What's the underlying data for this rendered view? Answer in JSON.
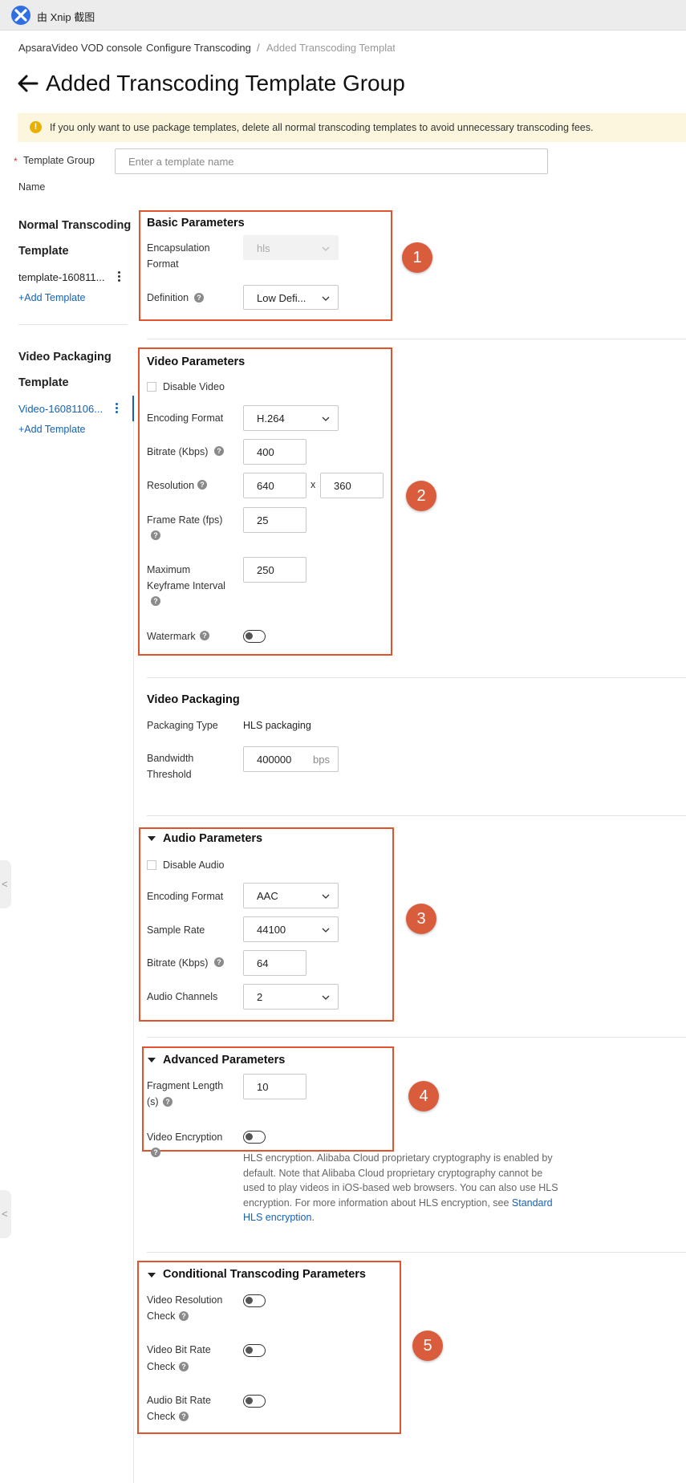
{
  "app": {
    "title": "由 Xnip 截图"
  },
  "breadcrumb": {
    "items": [
      "ApsaraVideo VOD console",
      "Configure Transcoding",
      "Added Transcoding Templat"
    ],
    "separator": "/"
  },
  "page": {
    "title": "Added Transcoding Template Group"
  },
  "notice": {
    "icon": "!",
    "text": "If you only want to use package templates, delete all normal transcoding templates to avoid unnecessary transcoding fees."
  },
  "template_group": {
    "required_mark": "*",
    "label_line1": "Template Group",
    "label_line2": "Name",
    "placeholder": "Enter a template name"
  },
  "sidebar": {
    "normal": {
      "heading_line1": "Normal Transcoding",
      "heading_line2": "Template",
      "item": "template-160811...",
      "add": "+Add Template"
    },
    "packaging": {
      "heading_line1": "Video Packaging",
      "heading_line2": "Template",
      "item": "Video-16081106...",
      "add": "+Add Template"
    }
  },
  "help_glyph": "?",
  "basic": {
    "title": "Basic Parameters",
    "encapsulation_label_1": "Encapsulation",
    "encapsulation_label_2": "Format",
    "encapsulation_value": "hls",
    "definition_label": "Definition",
    "definition_value": "Low Defi..."
  },
  "video": {
    "title": "Video Parameters",
    "disable_label": "Disable Video",
    "encoding_label": "Encoding Format",
    "encoding_value": "H.264",
    "bitrate_label": "Bitrate (Kbps)",
    "bitrate_value": "400",
    "resolution_label": "Resolution",
    "width": "640",
    "times": "x",
    "height": "360",
    "framerate_label": "Frame Rate (fps)",
    "framerate_value": "25",
    "keyframe_label_1": "Maximum",
    "keyframe_label_2": "Keyframe Interval",
    "keyframe_value": "250",
    "watermark_label": "Watermark"
  },
  "packaging": {
    "title": "Video Packaging",
    "type_label": "Packaging Type",
    "type_value": "HLS packaging",
    "bandwidth_label_1": "Bandwidth",
    "bandwidth_label_2": "Threshold",
    "bandwidth_value": "400000",
    "bandwidth_unit": "bps"
  },
  "audio": {
    "title": "Audio Parameters",
    "disable_label": "Disable Audio",
    "encoding_label": "Encoding Format",
    "encoding_value": "AAC",
    "sample_label": "Sample Rate",
    "sample_value": "44100",
    "bitrate_label": "Bitrate (Kbps)",
    "bitrate_value": "64",
    "channels_label": "Audio Channels",
    "channels_value": "2"
  },
  "advanced": {
    "title": "Advanced Parameters",
    "fragment_label_1": "Fragment Length",
    "fragment_label_2": "(s)",
    "fragment_value": "10",
    "encryption_label": "Video Encryption",
    "desc_line1": "HLS encryption. Alibaba Cloud proprietary cryptography is enabled by",
    "desc_line2": "default. Note that Alibaba Cloud proprietary cryptography cannot be",
    "desc_line3": "used to play videos in iOS-based web browsers. You can also use HLS",
    "desc_line4": "encryption. For more information about HLS encryption, see ",
    "desc_link_1": "Standard",
    "desc_link_2": "HLS encryption",
    "desc_end": "."
  },
  "conditional": {
    "title": "Conditional Transcoding Parameters",
    "res_label_1": "Video Resolution",
    "res_label_2": "Check",
    "vbr_label_1": "Video Bit Rate",
    "vbr_label_2": "Check",
    "abr_label_1": "Audio Bit Rate",
    "abr_label_2": "Check"
  },
  "annotations": [
    "1",
    "2",
    "3",
    "4",
    "5"
  ],
  "edge_tabs": [
    "<",
    "<"
  ],
  "colors": {
    "highlight": "#e0532e",
    "badge": "#d95c3d",
    "link": "#1462b5",
    "notice_bg": "#fdf6de"
  }
}
